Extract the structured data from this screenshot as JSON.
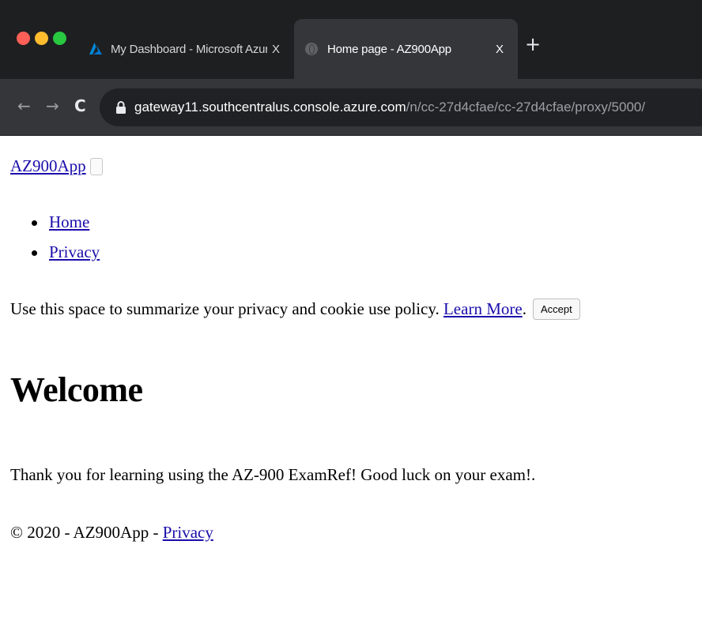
{
  "browser": {
    "tabs": [
      {
        "title": "My Dashboard - Microsoft Azure",
        "close": "X",
        "active": false
      },
      {
        "title": "Home page - AZ900App",
        "close": "X",
        "active": true
      }
    ],
    "new_tab": "+",
    "nav": {
      "back": "←",
      "forward": "→",
      "reload": "C"
    },
    "address": {
      "host": "gateway11.southcentralus.console.azure.com",
      "path": "/n/cc-27d4cfae/cc-27d4cfae/proxy/5000/"
    },
    "colors": {
      "close": "#fe5f57",
      "minimize": "#febc2e",
      "zoom": "#28c840",
      "azure_logo": "#0078d4"
    }
  },
  "page": {
    "brand": "AZ900App",
    "nav_items": [
      "Home",
      "Privacy"
    ],
    "cookie": {
      "text": "Use this space to summarize your privacy and cookie use policy.",
      "link": "Learn More",
      "period": ".",
      "button": "Accept"
    },
    "heading": "Welcome",
    "message": "Thank you for learning using the AZ-900 ExamRef! Good luck on your exam!.",
    "footer": {
      "prefix": "© 2020 - AZ900App - ",
      "link": "Privacy"
    }
  }
}
